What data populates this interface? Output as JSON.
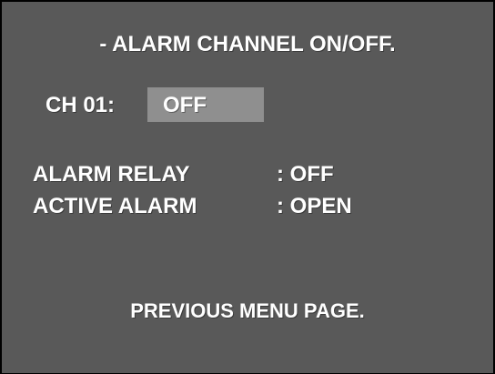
{
  "title": "- ALARM CHANNEL ON/OFF.",
  "channel": {
    "label": "CH 01:",
    "value": "OFF"
  },
  "settings": [
    {
      "label": "ALARM RELAY",
      "value": ": OFF"
    },
    {
      "label": "ACTIVE ALARM",
      "value": ": OPEN"
    }
  ],
  "footer": {
    "previous_menu": "PREVIOUS MENU PAGE."
  },
  "colors": {
    "background": "#595959",
    "selection_highlight": "#8f8f8f",
    "text": "#ffffff",
    "border": "#000000"
  }
}
